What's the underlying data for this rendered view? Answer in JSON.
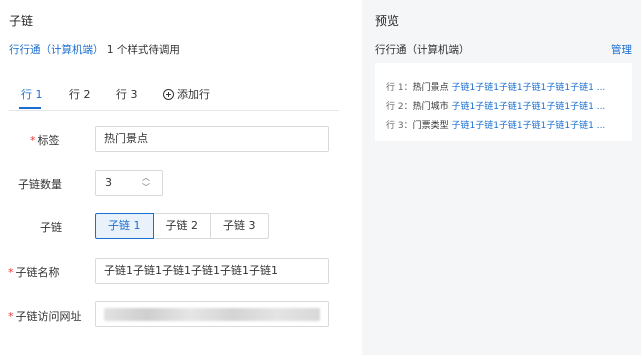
{
  "config": {
    "section_title": "子链",
    "style_link": "行行通（计算机端）",
    "style_suffix": "1 个样式待调用",
    "tabs": [
      "行 1",
      "行 2",
      "行 3"
    ],
    "add_row_label": "添加行",
    "form": {
      "tag_label": "标签",
      "tag_value": "热门景点",
      "count_label": "子链数量",
      "count_value": "3",
      "chain_label": "子链",
      "chain_options": [
        "子链 1",
        "子链 2",
        "子链 3"
      ],
      "name_label": "子链名称",
      "name_value": "子链1子链1子链1子链1子链1子链1",
      "url_label": "子链访问网址"
    }
  },
  "preview": {
    "title": "预览",
    "subtitle": "行行通（计算机端）",
    "manage_label": "管理",
    "rows": [
      {
        "prefix": "行 1：",
        "tag": "热门景点",
        "chains": "子链1子链1子链1子链1子链1子链1 ..."
      },
      {
        "prefix": "行 2：",
        "tag": "热门城市",
        "chains": "子链1子链1子链1子链1子链1子链1 ..."
      },
      {
        "prefix": "行 3：",
        "tag": "门票类型",
        "chains": "子链1子链1子链1子链1子链1子链1 ..."
      }
    ]
  },
  "colors": {
    "accent": "#1b6fd0",
    "required": "#e23c3c",
    "panel_bg": "#f5f6f8"
  },
  "icons": {
    "add_row": "plus-circle-icon",
    "stepper_up": "chevron-up-icon",
    "stepper_down": "chevron-down-icon"
  }
}
